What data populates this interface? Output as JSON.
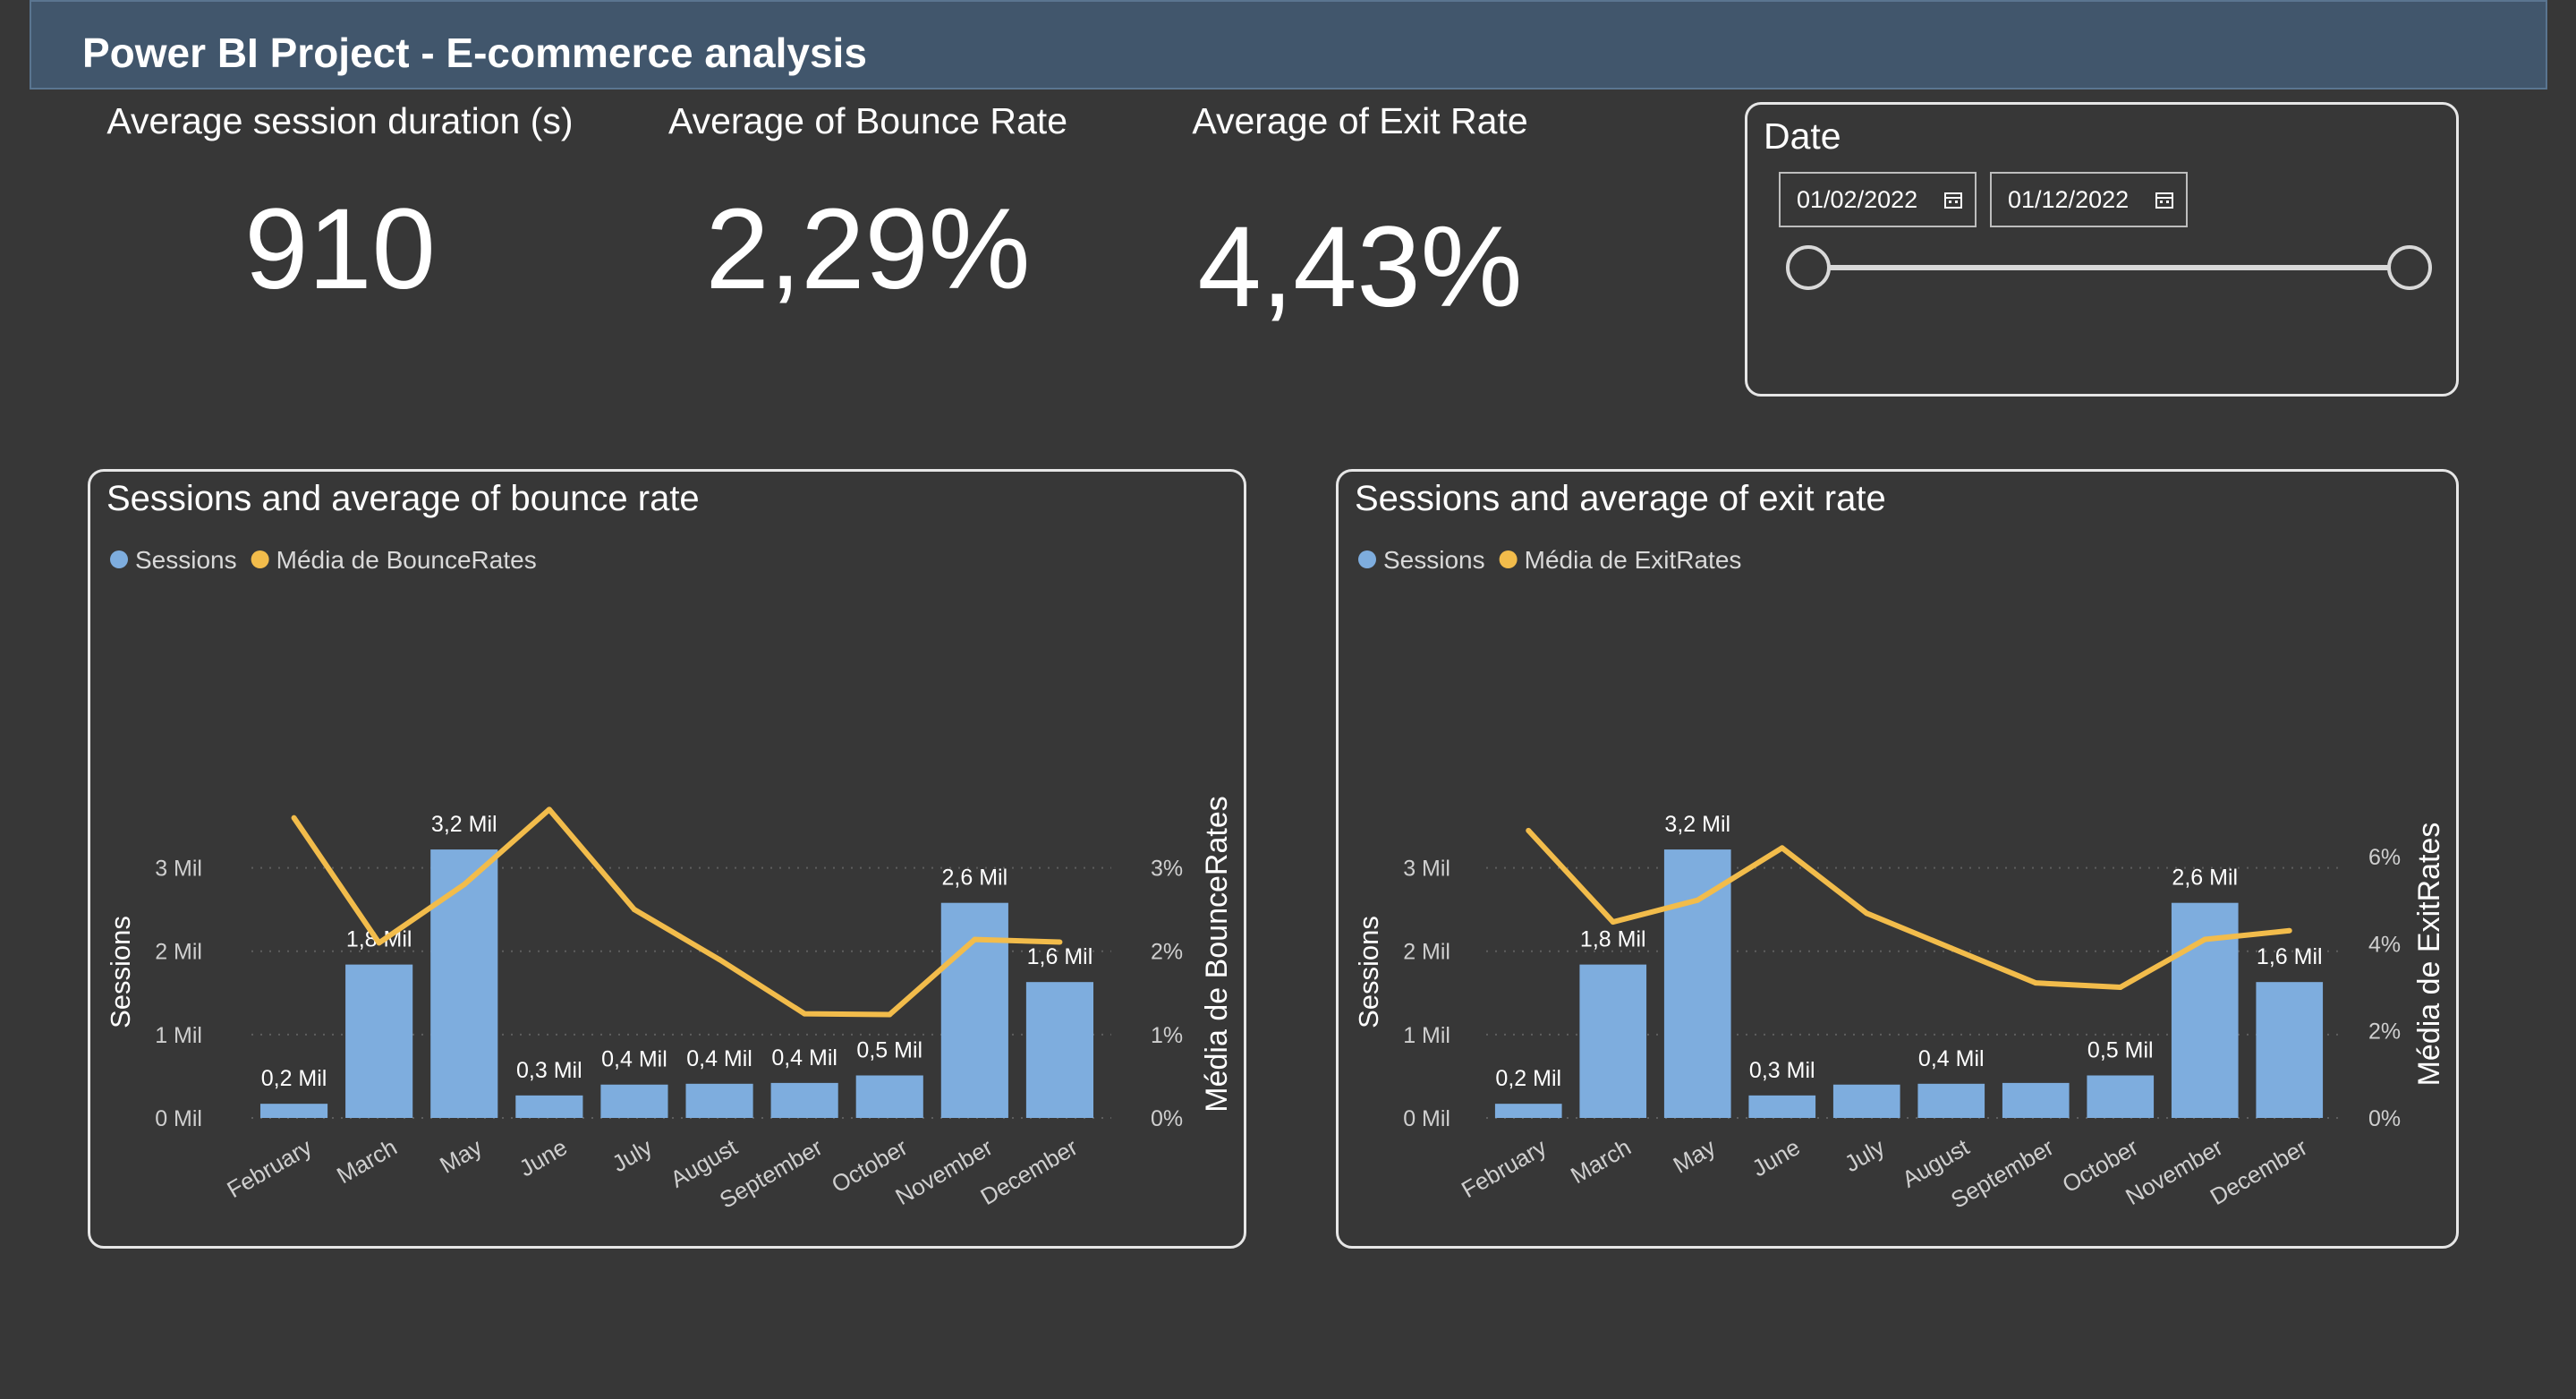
{
  "header": {
    "title": "Power BI Project - E-commerce analysis"
  },
  "kpis": [
    {
      "label": "Average session duration (s)",
      "value": "910"
    },
    {
      "label": "Average of Bounce Rate",
      "value": "2,29%"
    },
    {
      "label": "Average of Exit Rate",
      "value": "4,43%"
    }
  ],
  "date_filter": {
    "title": "Date",
    "start": "01/02/2022",
    "end": "01/12/2022",
    "range_fraction": [
      0,
      1
    ]
  },
  "colors": {
    "bars": "#7eadde",
    "line": "#f2bc4b",
    "background": "#373737",
    "header": "#41566c"
  },
  "chart_data": [
    {
      "type": "bar+line",
      "title": "Sessions and average of bounce rate",
      "categories": [
        "February",
        "March",
        "May",
        "June",
        "July",
        "August",
        "September",
        "October",
        "November",
        "December"
      ],
      "series": [
        {
          "name": "Sessions",
          "axis": "left",
          "values": [
            0.17,
            1.84,
            3.22,
            0.27,
            0.4,
            0.41,
            0.42,
            0.51,
            2.58,
            1.63
          ],
          "labels": [
            "0,2 Mil",
            "1,8 Mil",
            "3,2 Mil",
            "0,3 Mil",
            "0,4 Mil",
            "0,4 Mil",
            "0,4 Mil",
            "0,5 Mil",
            "2,6 Mil",
            "1,6 Mil"
          ]
        },
        {
          "name": "Média de BounceRates",
          "axis": "right",
          "values": [
            3.6,
            2.1,
            2.8,
            3.7,
            2.5,
            1.9,
            1.25,
            1.24,
            2.14,
            2.11
          ]
        }
      ],
      "ylabel": "Sessions",
      "y2label": "Média de BounceRates",
      "ylim": [
        0,
        3.5
      ],
      "y2lim": [
        0,
        3.5
      ],
      "yticks": [
        "0 Mil",
        "1 Mil",
        "2 Mil",
        "3 Mil"
      ],
      "y2ticks": [
        "0%",
        "1%",
        "2%",
        "3%"
      ],
      "legend": "top-left",
      "grid": true
    },
    {
      "type": "bar+line",
      "title": "Sessions and average of exit rate",
      "categories": [
        "February",
        "March",
        "May",
        "June",
        "July",
        "August",
        "September",
        "October",
        "November",
        "December"
      ],
      "series": [
        {
          "name": "Sessions",
          "axis": "left",
          "values": [
            0.17,
            1.84,
            3.22,
            0.27,
            0.4,
            0.41,
            0.42,
            0.51,
            2.58,
            1.63
          ],
          "labels": [
            "0,2 Mil",
            "1,8 Mil",
            "3,2 Mil",
            "0,3 Mil",
            "",
            "0,4 Mil",
            "",
            "0,5 Mil",
            "2,6 Mil",
            "1,6 Mil"
          ]
        },
        {
          "name": "Média de ExitRates",
          "axis": "right",
          "values": [
            6.6,
            4.5,
            5.0,
            6.2,
            4.7,
            3.9,
            3.1,
            3.0,
            4.1,
            4.3
          ]
        }
      ],
      "ylabel": "Sessions",
      "y2label": "Média de ExitRates",
      "ylim": [
        0,
        3.5
      ],
      "y2lim": [
        0,
        6.7
      ],
      "yticks": [
        "0 Mil",
        "1 Mil",
        "2 Mil",
        "3 Mil"
      ],
      "y2ticks": [
        "0%",
        "2%",
        "4%",
        "6%"
      ],
      "legend": "top-left",
      "grid": true
    }
  ]
}
